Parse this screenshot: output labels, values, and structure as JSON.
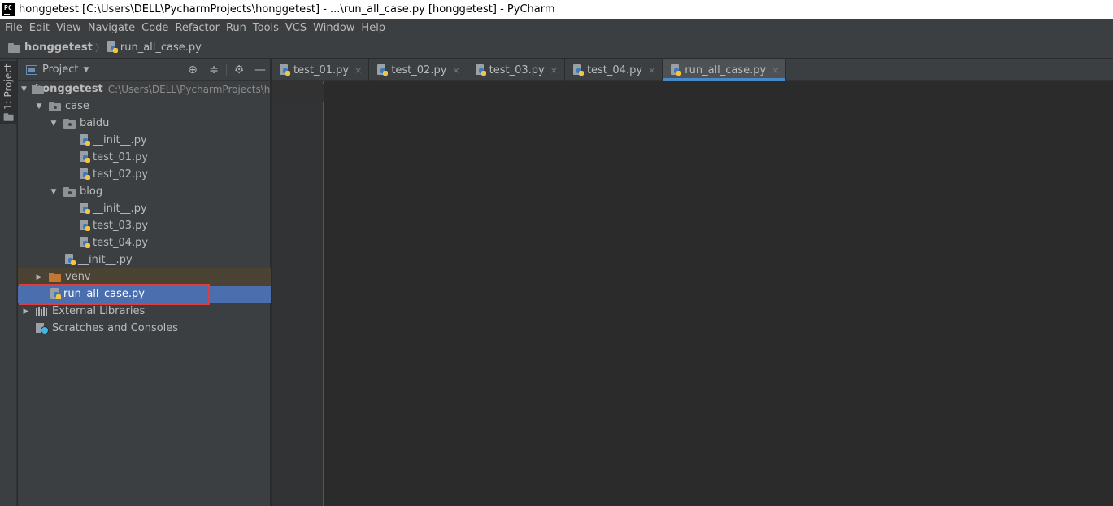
{
  "window": {
    "logo_text": "PC",
    "title": "honggetest [C:\\Users\\DELL\\PycharmProjects\\honggetest] - ...\\run_all_case.py [honggetest] - PyCharm"
  },
  "menu": [
    "File",
    "Edit",
    "View",
    "Navigate",
    "Code",
    "Refactor",
    "Run",
    "Tools",
    "VCS",
    "Window",
    "Help"
  ],
  "breadcrumb": {
    "project": "honggetest",
    "file": "run_all_case.py"
  },
  "tool_strip": {
    "project_tab_label": "1: Project"
  },
  "project_panel": {
    "view_label": "Project",
    "tree": [
      {
        "label": "honggetest",
        "path": "C:\\Users\\DELL\\PycharmProjects\\honggetest"
      },
      {
        "label": "case"
      },
      {
        "label": "baidu"
      },
      {
        "label": "__init__.py"
      },
      {
        "label": "test_01.py"
      },
      {
        "label": "test_02.py"
      },
      {
        "label": "blog"
      },
      {
        "label": "__init__.py"
      },
      {
        "label": "test_03.py"
      },
      {
        "label": "test_04.py"
      },
      {
        "label": "__init__.py"
      },
      {
        "label": "venv"
      },
      {
        "label": "run_all_case.py",
        "selected": true
      },
      {
        "label": "External Libraries"
      },
      {
        "label": "Scratches and Consoles"
      }
    ]
  },
  "editor": {
    "tabs": [
      {
        "label": "test_01.py"
      },
      {
        "label": "test_02.py"
      },
      {
        "label": "test_03.py"
      },
      {
        "label": "test_04.py"
      },
      {
        "label": "run_all_case.py",
        "active": true
      }
    ],
    "close_glyph": "×"
  },
  "colors": {
    "background": "#2b2b2b",
    "panel": "#3c3f41",
    "selection": "#4b6eaf",
    "highlight_box": "#e03c3c",
    "active_tab_underline": "#4a88c7",
    "venv_folder": "#c57633"
  }
}
